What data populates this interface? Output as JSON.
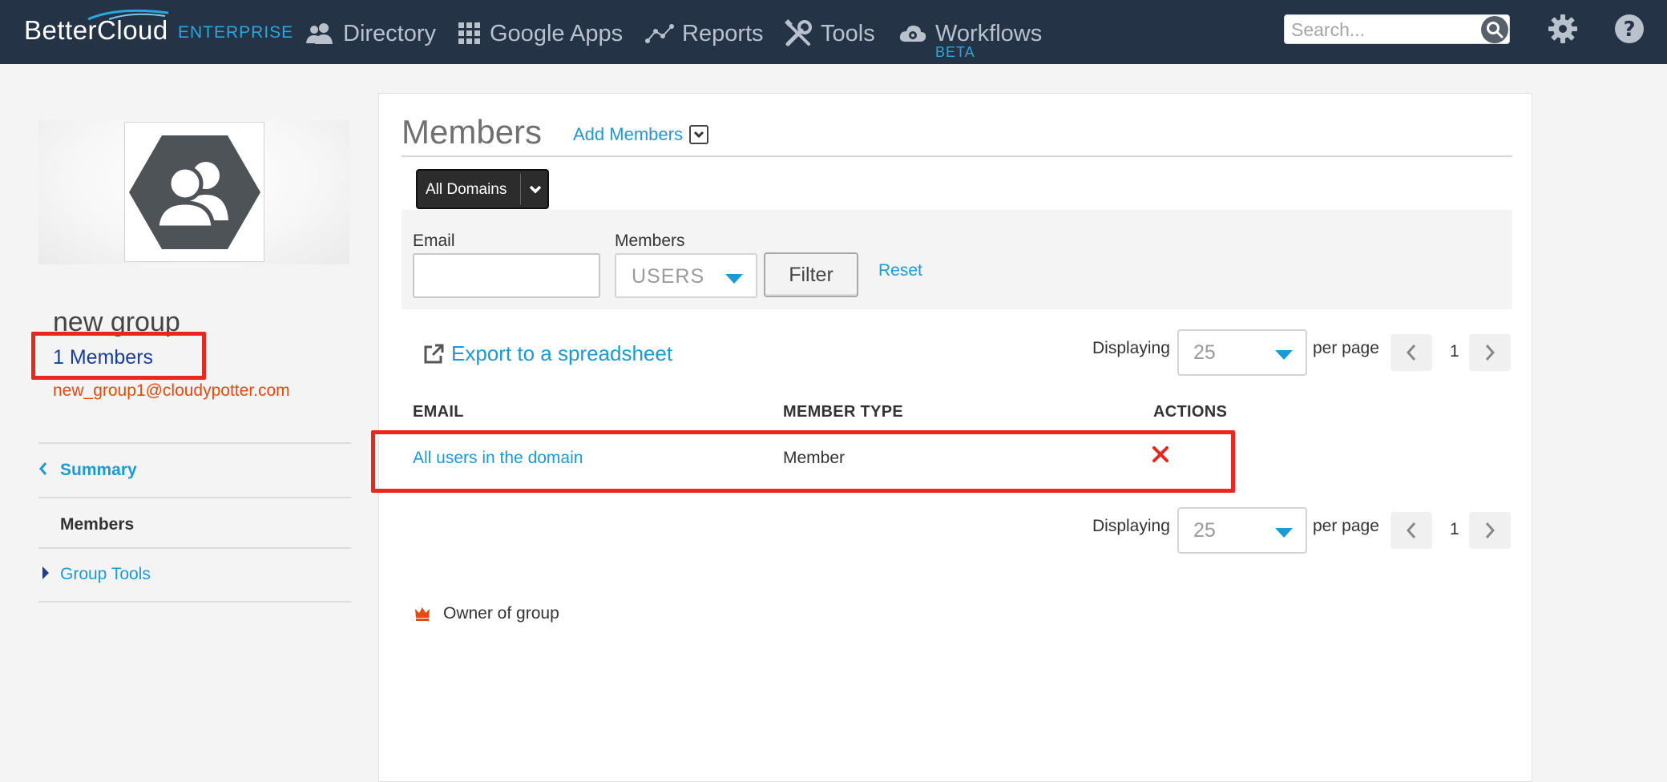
{
  "brand": {
    "name": "BetterCloud",
    "edition": "ENTERPRISE"
  },
  "nav": {
    "items": [
      {
        "label": "Directory",
        "icon": "users-icon"
      },
      {
        "label": "Google Apps",
        "icon": "grid-icon"
      },
      {
        "label": "Reports",
        "icon": "chart-line-icon"
      },
      {
        "label": "Tools",
        "icon": "tools-icon"
      },
      {
        "label": "Workflows",
        "icon": "cloud-gear-icon"
      }
    ],
    "workflows_badge": "BETA",
    "search_placeholder": "Search..."
  },
  "group": {
    "name": "new group",
    "members_count": "1 Members",
    "email": "new_group1@cloudypotter.com"
  },
  "sidebar": {
    "items": [
      {
        "label": "Summary",
        "state": "back-link"
      },
      {
        "label": "Members",
        "state": "active"
      },
      {
        "label": "Group Tools",
        "state": "expandable"
      }
    ]
  },
  "panel": {
    "title": "Members",
    "add_members": "Add Members",
    "domain_filter": "All Domains",
    "filter": {
      "email_label": "Email",
      "email_value": "",
      "members_label": "Members",
      "members_value": "USERS",
      "filter_button": "Filter",
      "reset_link": "Reset"
    },
    "export_link": "Export to a spreadsheet",
    "pagination": {
      "displaying_label": "Displaying",
      "per_page_value": "25",
      "per_page_label": "per page",
      "current_page": "1"
    },
    "table": {
      "columns": [
        "EMAIL",
        "MEMBER TYPE",
        "ACTIONS"
      ],
      "rows": [
        {
          "email": "All users in the domain",
          "member_type": "Member",
          "action": "delete"
        }
      ]
    },
    "legend": {
      "owner_label": "Owner of group"
    }
  },
  "colors": {
    "nav_bg": "#243446",
    "link": "#1b9ad6",
    "highlight": "#e8281e",
    "email_accent": "#e8490f"
  }
}
